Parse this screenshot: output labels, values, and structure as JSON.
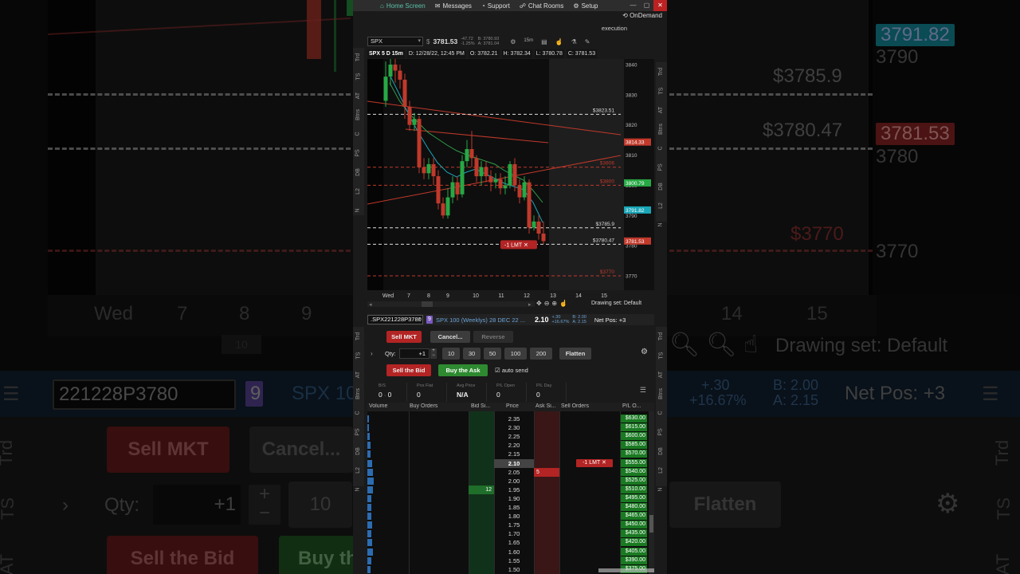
{
  "top_nav": {
    "items": [
      {
        "label": "Home Screen",
        "icon": "home-icon"
      },
      {
        "label": "Messages",
        "icon": "envelope-icon"
      },
      {
        "label": "Support",
        "icon": "headset-icon"
      },
      {
        "label": "Chat Rooms",
        "icon": "chat-icon"
      },
      {
        "label": "Setup",
        "icon": "gear-icon"
      }
    ],
    "ondemand": "OnDemand",
    "execution": "execution"
  },
  "left_tabs": [
    "Trd",
    "TS",
    "AT",
    "Btns",
    "C",
    "PS",
    "DB",
    "L2",
    "N"
  ],
  "right_tabs": [
    "Trd",
    "TS",
    "AT",
    "Btns",
    "C",
    "PS",
    "DB",
    "L2",
    "N"
  ],
  "chart": {
    "symbol": "SPX",
    "last": "3781.53",
    "chg_1": "-47.72",
    "chg_2": "-1.25%",
    "bid": "B: 3780.93",
    "ask": "A: 3781.04",
    "title": "SPX 5 D 15m",
    "info": [
      "D: 12/28/22, 12:45 PM",
      "O: 3782.21",
      "H: 3782.34",
      "L: 3780.78",
      "C: 3781.53"
    ],
    "timeframe": "15m",
    "price_levels": [
      {
        "label": "$3823.51",
        "style": "white"
      },
      {
        "label": "$3806",
        "style": "red"
      },
      {
        "label": "$3800",
        "style": "red"
      },
      {
        "label": "$3785.9",
        "style": "white"
      },
      {
        "label": "$3780.47",
        "style": "white"
      },
      {
        "label": "$3770",
        "style": "red"
      }
    ],
    "price_scale": [
      "3840",
      "3830",
      "3820",
      "3810",
      "3800",
      "3790",
      "3780",
      "3770"
    ],
    "price_boxes": [
      {
        "label": "3814.33",
        "color": "#c0392b"
      },
      {
        "label": "3800.79",
        "color": "#27a845"
      },
      {
        "label": "3791.82",
        "color": "#1aa6b8"
      },
      {
        "label": "3781.53",
        "color": "#c0392b"
      }
    ],
    "order_tag": "-1 LMT",
    "x_labels": [
      "Wed",
      "7",
      "8",
      "9",
      "10",
      "11",
      "12",
      "13",
      "14",
      "15"
    ],
    "drawing_set": "Drawing set: Default"
  },
  "order": {
    "option_symbol": ".SPX221228P3780",
    "badge": "9",
    "description": "SPX 100 (Weeklys) 28 DEC 22 ...",
    "price": "2.10",
    "chg_1": "+.30",
    "chg_2": "+16.67%",
    "bid": "B: 2.00",
    "ask": "A: 2.15",
    "net_pos": "Net Pos: +3",
    "sell_mkt": "Sell MKT",
    "cancel": "Cancel...",
    "reverse": "Reverse",
    "qty_label": "Qty:",
    "qty_value": "+1",
    "qty_presets": [
      "10",
      "30",
      "50",
      "100",
      "200"
    ],
    "flatten": "Flatten",
    "sell_bid": "Sell the Bid",
    "buy_ask": "Buy the Ask",
    "auto_send": "auto send"
  },
  "position_summary": [
    {
      "label": "B/S",
      "value": "0",
      "value2": "0"
    },
    {
      "label": "Pos Flat",
      "value": "0"
    },
    {
      "label": "Avg Price",
      "value": "N/A"
    },
    {
      "label": "P/L Open",
      "value": "0"
    },
    {
      "label": "P/L Day",
      "value": "0"
    }
  ],
  "ladder": {
    "headers": [
      "Volume",
      "Buy Orders",
      "Bid Si...",
      "Price",
      "Ask Si...",
      "Sell Orders",
      "P/L O..."
    ],
    "current_price": "2.10",
    "rows": [
      {
        "price": "2.35",
        "pl": "$630.00",
        "vol": 0.08
      },
      {
        "price": "2.30",
        "pl": "$615.00",
        "vol": 0.1
      },
      {
        "price": "2.25",
        "pl": "$600.00",
        "vol": 0.12
      },
      {
        "price": "2.20",
        "pl": "$585.00",
        "vol": 0.15
      },
      {
        "price": "2.15",
        "pl": "$570.00",
        "vol": 0.18
      },
      {
        "price": "2.10",
        "pl": "$555.00",
        "vol": 0.25,
        "sell_order": "-1 LMT"
      },
      {
        "price": "2.05",
        "pl": "$540.00",
        "vol": 0.3,
        "ask_size": "5"
      },
      {
        "price": "2.00",
        "pl": "$525.00",
        "vol": 0.35
      },
      {
        "price": "1.95",
        "pl": "$510.00",
        "vol": 0.28,
        "bid_size": "12"
      },
      {
        "price": "1.90",
        "pl": "$495.00",
        "vol": 0.22
      },
      {
        "price": "1.85",
        "pl": "$480.00",
        "vol": 0.2
      },
      {
        "price": "1.80",
        "pl": "$465.00",
        "vol": 0.22
      },
      {
        "price": "1.75",
        "pl": "$450.00",
        "vol": 0.26
      },
      {
        "price": "1.70",
        "pl": "$435.00",
        "vol": 0.2
      },
      {
        "price": "1.65",
        "pl": "$420.00",
        "vol": 0.24
      },
      {
        "price": "1.60",
        "pl": "$405.00",
        "vol": 0.3
      },
      {
        "price": "1.55",
        "pl": "$390.00",
        "vol": 0.22
      },
      {
        "price": "1.50",
        "pl": "$375.00",
        "vol": 0.18
      }
    ]
  },
  "background": {
    "scale_labels": [
      "3790",
      "3780",
      "3770"
    ],
    "level_labels": [
      "$3785.9",
      "$3780.47",
      "$3770"
    ],
    "price_boxes": [
      "3791.82",
      "3781.53"
    ],
    "x_labels": [
      "Wed",
      "7",
      "8",
      "9",
      "14",
      "15"
    ],
    "drawing_set": "Drawing set: Default",
    "option_symbol": "221228P3780",
    "badge": "9",
    "desc_fragment": "SPX 10",
    "chg_1": "+.30",
    "chg_2": "+16.67%",
    "bid": "B: 2.00",
    "ask": "A: 2.15",
    "net_pos": "Net Pos: +3",
    "sell_mkt": "Sell MKT",
    "cancel": "Cancel...",
    "qty_label": "Qty:",
    "qty_value": "+1",
    "qty_preset": "10",
    "flatten": "Flatten",
    "sell_bid": "Sell the Bid",
    "buy_fragment": "Buy th",
    "side_tabs": [
      "Trd",
      "TS",
      "AT"
    ],
    "scroll_label": "10"
  }
}
